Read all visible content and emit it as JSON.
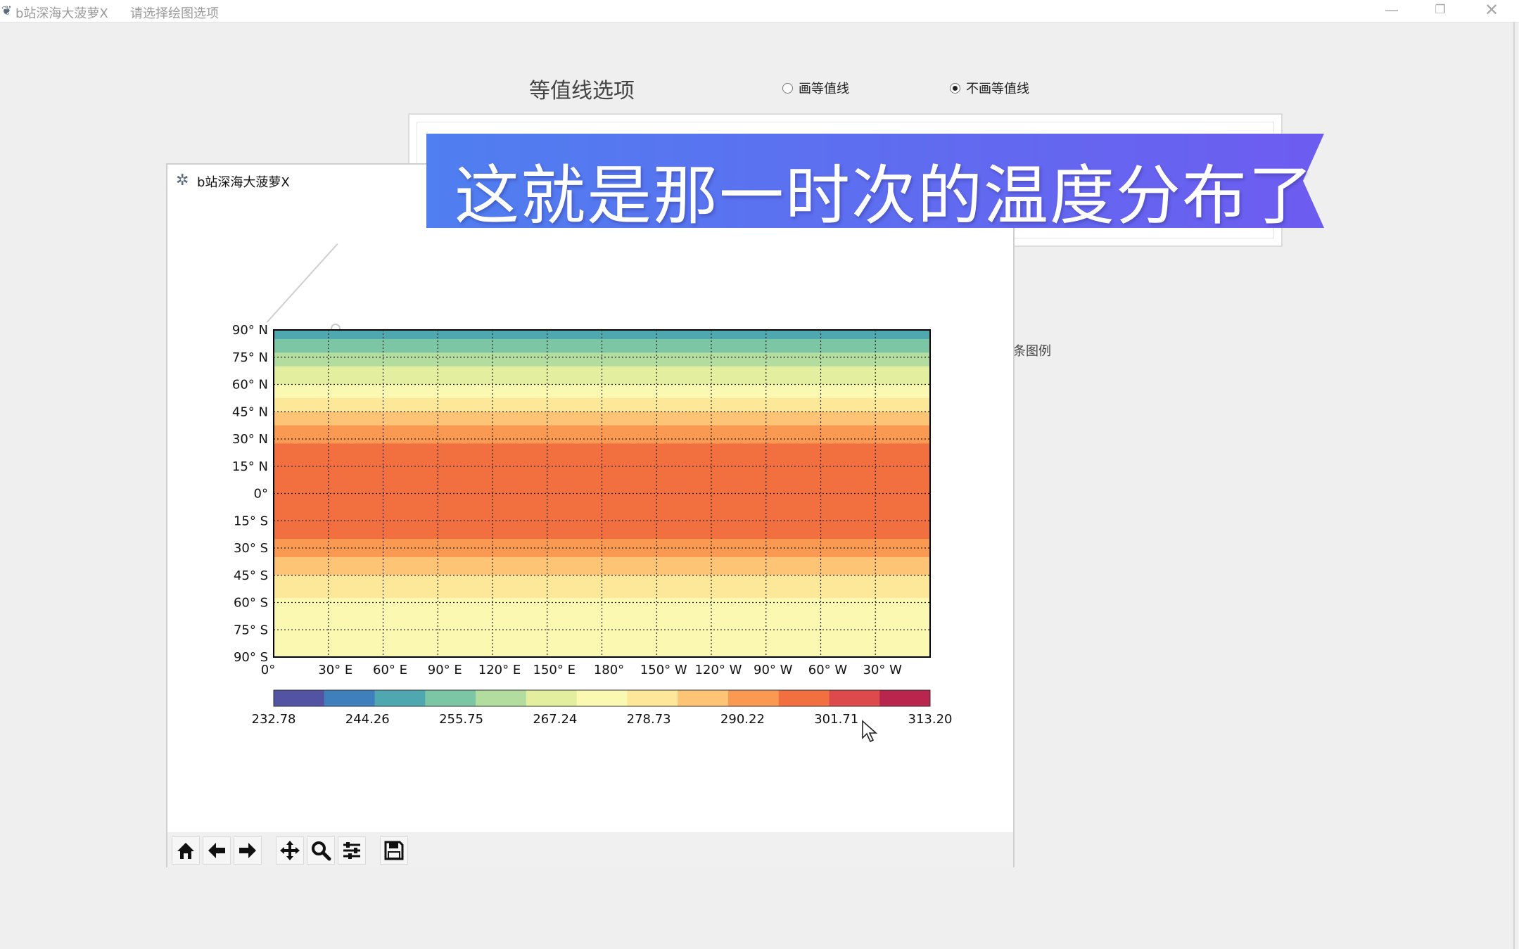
{
  "window": {
    "title": "b站深海大菠萝X",
    "subtitle": "请选择绘图选项"
  },
  "options": {
    "contour_label": "等值线选项",
    "radio_draw": "画等值线",
    "radio_nodraw": "不画等值线",
    "selected": "不画等值线",
    "legend_text": "条图例"
  },
  "figure_window": {
    "title": "b站深海大菠萝X",
    "toolbar": [
      "home-icon",
      "back-arrow-icon",
      "forward-arrow-icon",
      "pan-icon",
      "zoom-icon",
      "configure-icon",
      "save-icon"
    ]
  },
  "banner": {
    "text": "这就是那一时次的温度分布了"
  },
  "chart_data": {
    "type": "heatmap",
    "y_ticks": [
      "90° N",
      "75° N",
      "60° N",
      "45° N",
      "30° N",
      "15° N",
      "0°",
      "15° S",
      "30° S",
      "45° S",
      "60° S",
      "75° S",
      "90° S"
    ],
    "x_ticks": [
      "0°",
      "30° E",
      "60° E",
      "90° E",
      "120° E",
      "150° E",
      "180°",
      "150° W",
      "120° W",
      "90° W",
      "60° W",
      "30° W"
    ],
    "colorbar_ticks": [
      "232.78",
      "244.26",
      "255.75",
      "267.24",
      "278.73",
      "290.22",
      "301.71",
      "313.20"
    ],
    "colorbar_range": [
      232.78,
      313.2
    ],
    "colors": [
      "#5353a4",
      "#3f7fbc",
      "#4fa8b0",
      "#7cc6a6",
      "#b3dd9f",
      "#e3ef9e",
      "#fbf8b2",
      "#fde89a",
      "#fdc476",
      "#fa9a52",
      "#f2703f",
      "#dd4a4c",
      "#b8264e"
    ],
    "grid": true,
    "latitude_profile": [
      {
        "lat": 90,
        "value": 246
      },
      {
        "lat": 80,
        "value": 256
      },
      {
        "lat": 70,
        "value": 264
      },
      {
        "lat": 60,
        "value": 270
      },
      {
        "lat": 50,
        "value": 279
      },
      {
        "lat": 40,
        "value": 287
      },
      {
        "lat": 30,
        "value": 294
      },
      {
        "lat": 20,
        "value": 299
      },
      {
        "lat": 10,
        "value": 300
      },
      {
        "lat": 0,
        "value": 300
      },
      {
        "lat": -10,
        "value": 299
      },
      {
        "lat": -20,
        "value": 297
      },
      {
        "lat": -30,
        "value": 292
      },
      {
        "lat": -40,
        "value": 286
      },
      {
        "lat": -50,
        "value": 279
      },
      {
        "lat": -60,
        "value": 275
      },
      {
        "lat": -70,
        "value": 273
      },
      {
        "lat": -80,
        "value": 272
      },
      {
        "lat": -90,
        "value": 271
      }
    ]
  }
}
